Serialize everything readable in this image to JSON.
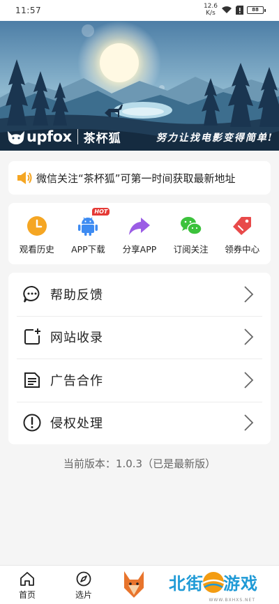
{
  "status_bar": {
    "time": "11:57",
    "net_speed_value": "12.6",
    "net_speed_unit": "K/s",
    "battery": "88"
  },
  "banner": {
    "brand_name": "upfox",
    "brand_cn": "茶杯狐",
    "slogan": "努力让找电影变得简单!"
  },
  "notice": {
    "text": "微信关注“茶杯狐”可第一时间获取最新地址"
  },
  "quick_actions": [
    {
      "label": "观看历史",
      "icon": "clock-icon",
      "color": "#f5a623"
    },
    {
      "label": "APP下载",
      "icon": "android-icon",
      "color": "#3d8bf2",
      "badge": "HOT"
    },
    {
      "label": "分享APP",
      "icon": "share-arrow-icon",
      "color": "#9b5de5"
    },
    {
      "label": "订阅关注",
      "icon": "wechat-icon",
      "color": "#3cc23c"
    },
    {
      "label": "领券中心",
      "icon": "coupon-tag-icon",
      "color": "#e84a4a"
    }
  ],
  "menu": [
    {
      "label": "帮助反馈",
      "icon": "chat-bubble-icon"
    },
    {
      "label": "网站收录",
      "icon": "add-bookmark-icon"
    },
    {
      "label": "广告合作",
      "icon": "document-icon"
    },
    {
      "label": "侵权处理",
      "icon": "alert-circle-icon"
    }
  ],
  "version_text": "当前版本：1.0.3（已是最新版）",
  "bottom_nav": {
    "home": "首页",
    "discover": "选片"
  },
  "watermark": {
    "text1": "北街",
    "text2": "游戏",
    "url": "WWW.BXHXS.NET"
  }
}
